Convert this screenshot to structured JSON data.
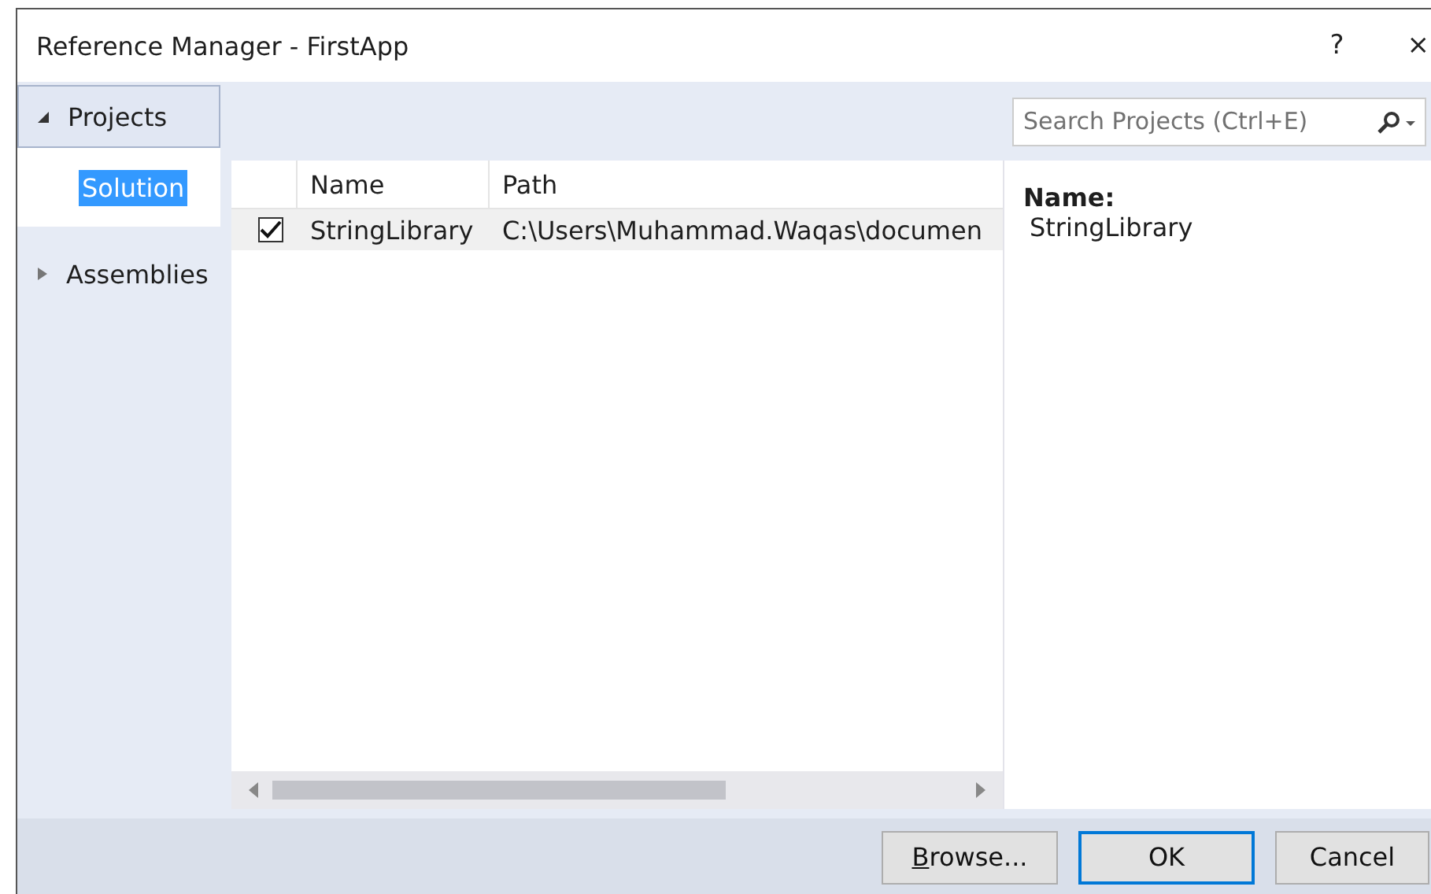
{
  "window": {
    "title": "Reference Manager - FirstApp",
    "help": "?",
    "close": "×"
  },
  "sidebar": {
    "items": [
      {
        "label": "Projects",
        "expanded": true,
        "selected": true,
        "children": [
          {
            "label": "Solution",
            "selected": true
          }
        ]
      },
      {
        "label": "Assemblies",
        "expanded": false,
        "selected": false
      }
    ]
  },
  "search": {
    "placeholder": "Search Projects (Ctrl+E)"
  },
  "table": {
    "columns": [
      "Name",
      "Path"
    ],
    "rows": [
      {
        "checked": true,
        "selected": true,
        "cells": [
          "StringLibrary",
          "C:\\Users\\Muhammad.Waqas\\documen"
        ]
      }
    ]
  },
  "details": {
    "label": "Name:",
    "value": "StringLibrary"
  },
  "buttons": [
    {
      "label": "Browse...",
      "underline_first": true,
      "default": false
    },
    {
      "label": "OK",
      "underline_first": false,
      "default": true
    },
    {
      "label": "Cancel",
      "underline_first": false,
      "default": false
    }
  ]
}
